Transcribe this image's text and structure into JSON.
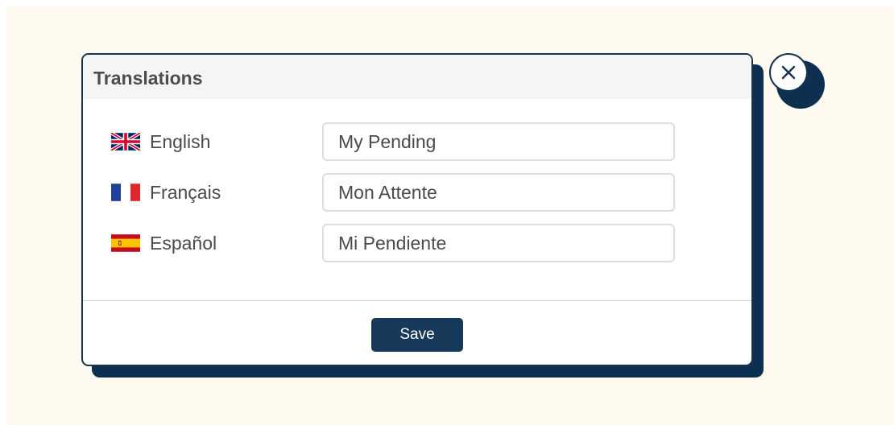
{
  "dialog": {
    "title": "Translations",
    "save_label": "Save",
    "close_icon": "close-icon"
  },
  "translations": [
    {
      "language": "English",
      "flag": "uk-flag-icon",
      "value": "My Pending"
    },
    {
      "language": "Français",
      "flag": "france-flag-icon",
      "value": "Mon Attente"
    },
    {
      "language": "Español",
      "flag": "spain-flag-icon",
      "value": "Mi Pendiente"
    }
  ],
  "colors": {
    "background": "#fefaf0",
    "accent": "#17395a",
    "shadow": "#0e3050"
  }
}
